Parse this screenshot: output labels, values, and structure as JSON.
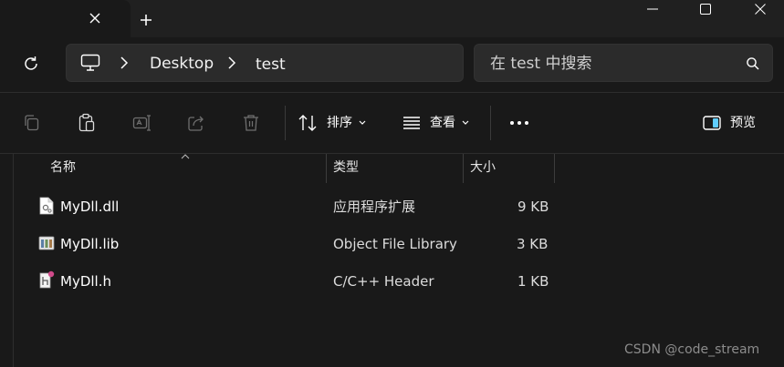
{
  "window": {
    "new_tab_label": "+",
    "close_tab_label": "×"
  },
  "address": {
    "crumbs": [
      "Desktop",
      "test"
    ]
  },
  "search": {
    "placeholder": "在 test 中搜索"
  },
  "toolbar": {
    "sort_label": "排序",
    "view_label": "查看",
    "more_label": "•••",
    "preview_label": "预览"
  },
  "columns": {
    "name": "名称",
    "type": "类型",
    "size": "大小"
  },
  "files": [
    {
      "name": "MyDll.dll",
      "type": "应用程序扩展",
      "size": "9 KB",
      "icon": "dll-file-icon"
    },
    {
      "name": "MyDll.lib",
      "type": "Object File Library",
      "size": "3 KB",
      "icon": "lib-file-icon"
    },
    {
      "name": "MyDll.h",
      "type": "C/C++ Header",
      "size": "1 KB",
      "icon": "header-file-icon"
    }
  ],
  "watermark": "CSDN @code_stream",
  "colors": {
    "background": "#191919",
    "titlebar": "#202020",
    "field": "#2b2b2b",
    "accent_preview": "#60cdff"
  }
}
